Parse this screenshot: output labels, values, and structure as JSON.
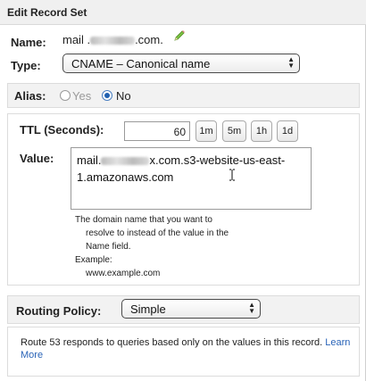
{
  "header": {
    "title": "Edit Record Set"
  },
  "name": {
    "label": "Name:",
    "prefix": "mail .",
    "suffix": ".com."
  },
  "type": {
    "label": "Type:",
    "selected": "CNAME – Canonical name"
  },
  "alias": {
    "label": "Alias:",
    "options": [
      "Yes",
      "No"
    ],
    "selected": "No"
  },
  "ttl": {
    "label": "TTL (Seconds):",
    "value": "60",
    "buttons": [
      "1m",
      "5m",
      "1h",
      "1d"
    ]
  },
  "value": {
    "label": "Value:",
    "line1_prefix": "mail.",
    "line1_suffix": "x.com.s3-website-us-east-",
    "line2": "1.amazonaws.com",
    "help_lines": [
      "The domain name that you want to",
      "resolve to instead of the value in the",
      "Name field."
    ],
    "example_label": "Example:",
    "example_value": "www.example.com"
  },
  "routing": {
    "label": "Routing Policy:",
    "selected": "Simple",
    "info": "Route 53 responds to queries based only on the values in this record.",
    "link1": "Learn",
    "link2": "More"
  },
  "colors": {
    "link": "#2a64b8",
    "radio_selected": "#2060b0"
  },
  "icons": {
    "edit": "pencil-icon",
    "select": "up-down-arrows-icon",
    "text_cursor": "i-beam-cursor-icon"
  }
}
